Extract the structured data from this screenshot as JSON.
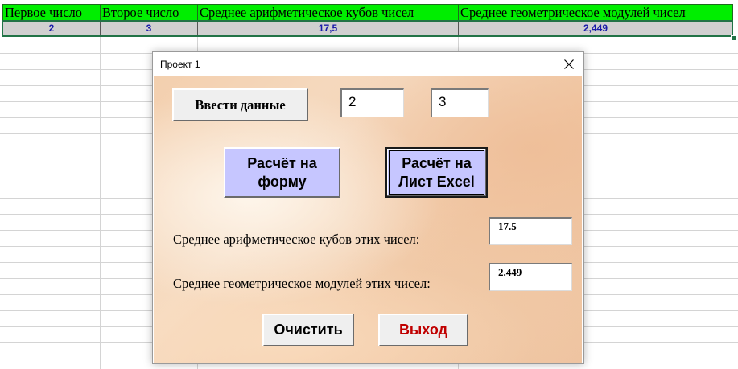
{
  "sheet": {
    "headers": [
      "Первое число",
      "Второе число",
      "Среднее арифметическое кубов чисел",
      "Среднее геометрическое модулей чисел"
    ],
    "values": [
      "2",
      "3",
      "17,5",
      "2,449"
    ]
  },
  "dialog": {
    "title": "Проект 1",
    "enter_button": "Ввести данные",
    "input1": "2",
    "input2": "3",
    "calc_form_button": "Расчёт на форму",
    "calc_sheet_button": "Расчёт на Лист Excel",
    "arith_label": "Среднее арифметическое кубов этих чисел:",
    "arith_value": "17.5",
    "geom_label": "Среднее геометрическое модулей этих чисел:",
    "geom_value": "2.449",
    "clear_button": "Очистить",
    "exit_button": "Выход"
  },
  "colors": {
    "header_green": "#00ee00",
    "value_text_blue": "#1a1aa8",
    "calc_button_bg": "#c6c6ff",
    "exit_text_red": "#c00000"
  },
  "icons": [
    "close-icon"
  ]
}
